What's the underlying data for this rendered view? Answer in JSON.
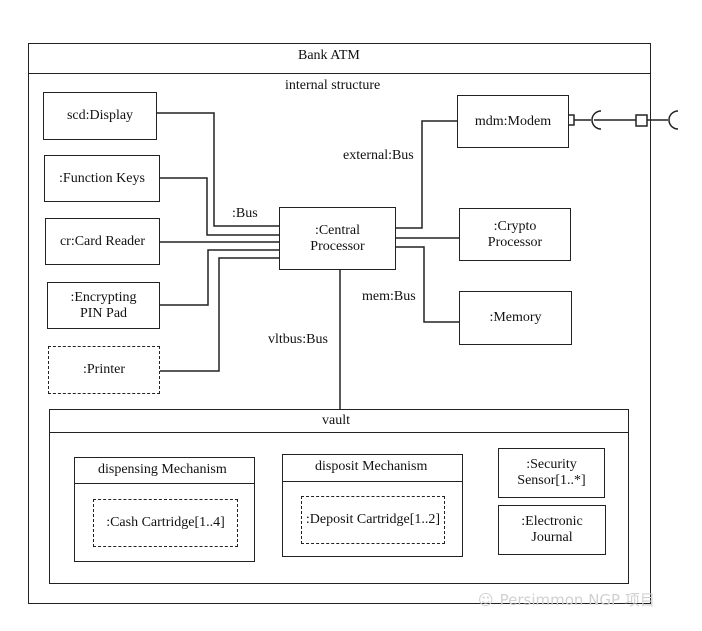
{
  "diagram": {
    "title": "Bank ATM",
    "compartment_label": "internal structure",
    "parts": {
      "display": "scd:Display",
      "function_keys": ":Function Keys",
      "card_reader": "cr:Card Reader",
      "pin_pad_line1": ":Encrypting",
      "pin_pad_line2": "PIN Pad",
      "printer": ":Printer",
      "central_line1": ":Central",
      "central_line2": "Processor",
      "modem": "mdm:Modem",
      "crypto_line1": ":Crypto",
      "crypto_line2": "Processor",
      "memory": ":Memory"
    },
    "connectors": {
      "bus": ":Bus",
      "external_bus": "external:Bus",
      "mem_bus": "mem:Bus",
      "vlt_bus": "vltbus:Bus"
    },
    "vault": {
      "title": "vault",
      "dispensing": {
        "title": "dispensing Mechanism",
        "part": ":Cash Cartridge[1..4]"
      },
      "deposit": {
        "title": "disposit Mechanism",
        "part": ":Deposit Cartridge[1..2]"
      },
      "security_line1": ":Security",
      "security_line2": "Sensor[1..*]",
      "journal_line1": ":Electronic",
      "journal_line2": "Journal"
    }
  },
  "watermark": "Persimmon NGP 项目"
}
